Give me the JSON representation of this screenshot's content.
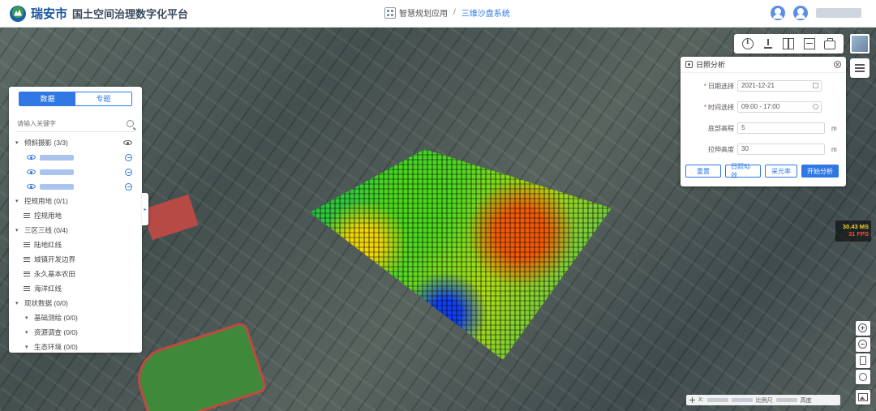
{
  "header": {
    "city": "瑞安市",
    "platform": "国土空间治理数字化平台",
    "breadcrumb": {
      "app": "智慧规划应用",
      "separator": "/",
      "current": "三维沙盘系统"
    },
    "icons": [
      "logo-icon",
      "grid-app-icon",
      "user-icon",
      "avatar-icon"
    ]
  },
  "left_panel": {
    "tabs": {
      "data": "数据",
      "topic": "专题"
    },
    "search_placeholder": "请输入关键字",
    "groups": [
      {
        "label": "倾斜摄影  (3/3)"
      },
      {
        "label": "控规用地  (0/1)",
        "children": [
          "控规用地"
        ]
      },
      {
        "label": "三区三线  (0/4)",
        "children": [
          "陆地红线",
          "城镇开发边界",
          "永久基本农田",
          "海洋红线"
        ]
      },
      {
        "label": "现状数据  (0/0)",
        "children": [
          "基础测绘  (0/0)",
          "资源调查  (0/0)",
          "生态环境  (0/0)"
        ]
      }
    ]
  },
  "sunlight_dialog": {
    "title": "日照分析",
    "fields": {
      "date": {
        "label": "日期选择",
        "value": "2021-12-21"
      },
      "time": {
        "label": "时间选择",
        "value": "09:00 - 17:00"
      },
      "base_height": {
        "label": "底部高程",
        "value": "5",
        "unit": "m"
      },
      "extrude_height": {
        "label": "拉伸高度",
        "value": "30",
        "unit": "m"
      }
    },
    "buttons": {
      "reset": "重置",
      "animate": "日照动效",
      "rate": "采光率",
      "start": "开始分析"
    }
  },
  "fps": {
    "ms": "30.43 MS",
    "fps": "31 FPS"
  },
  "statusbar": {
    "x_label": "X:",
    "view_label": "比例尺",
    "depth_label": "高度"
  },
  "colors": {
    "accent": "#2f78e4",
    "brand": "#17549d",
    "fps_ms": "#f6d12a",
    "fps_fps": "#ff4a3a"
  }
}
